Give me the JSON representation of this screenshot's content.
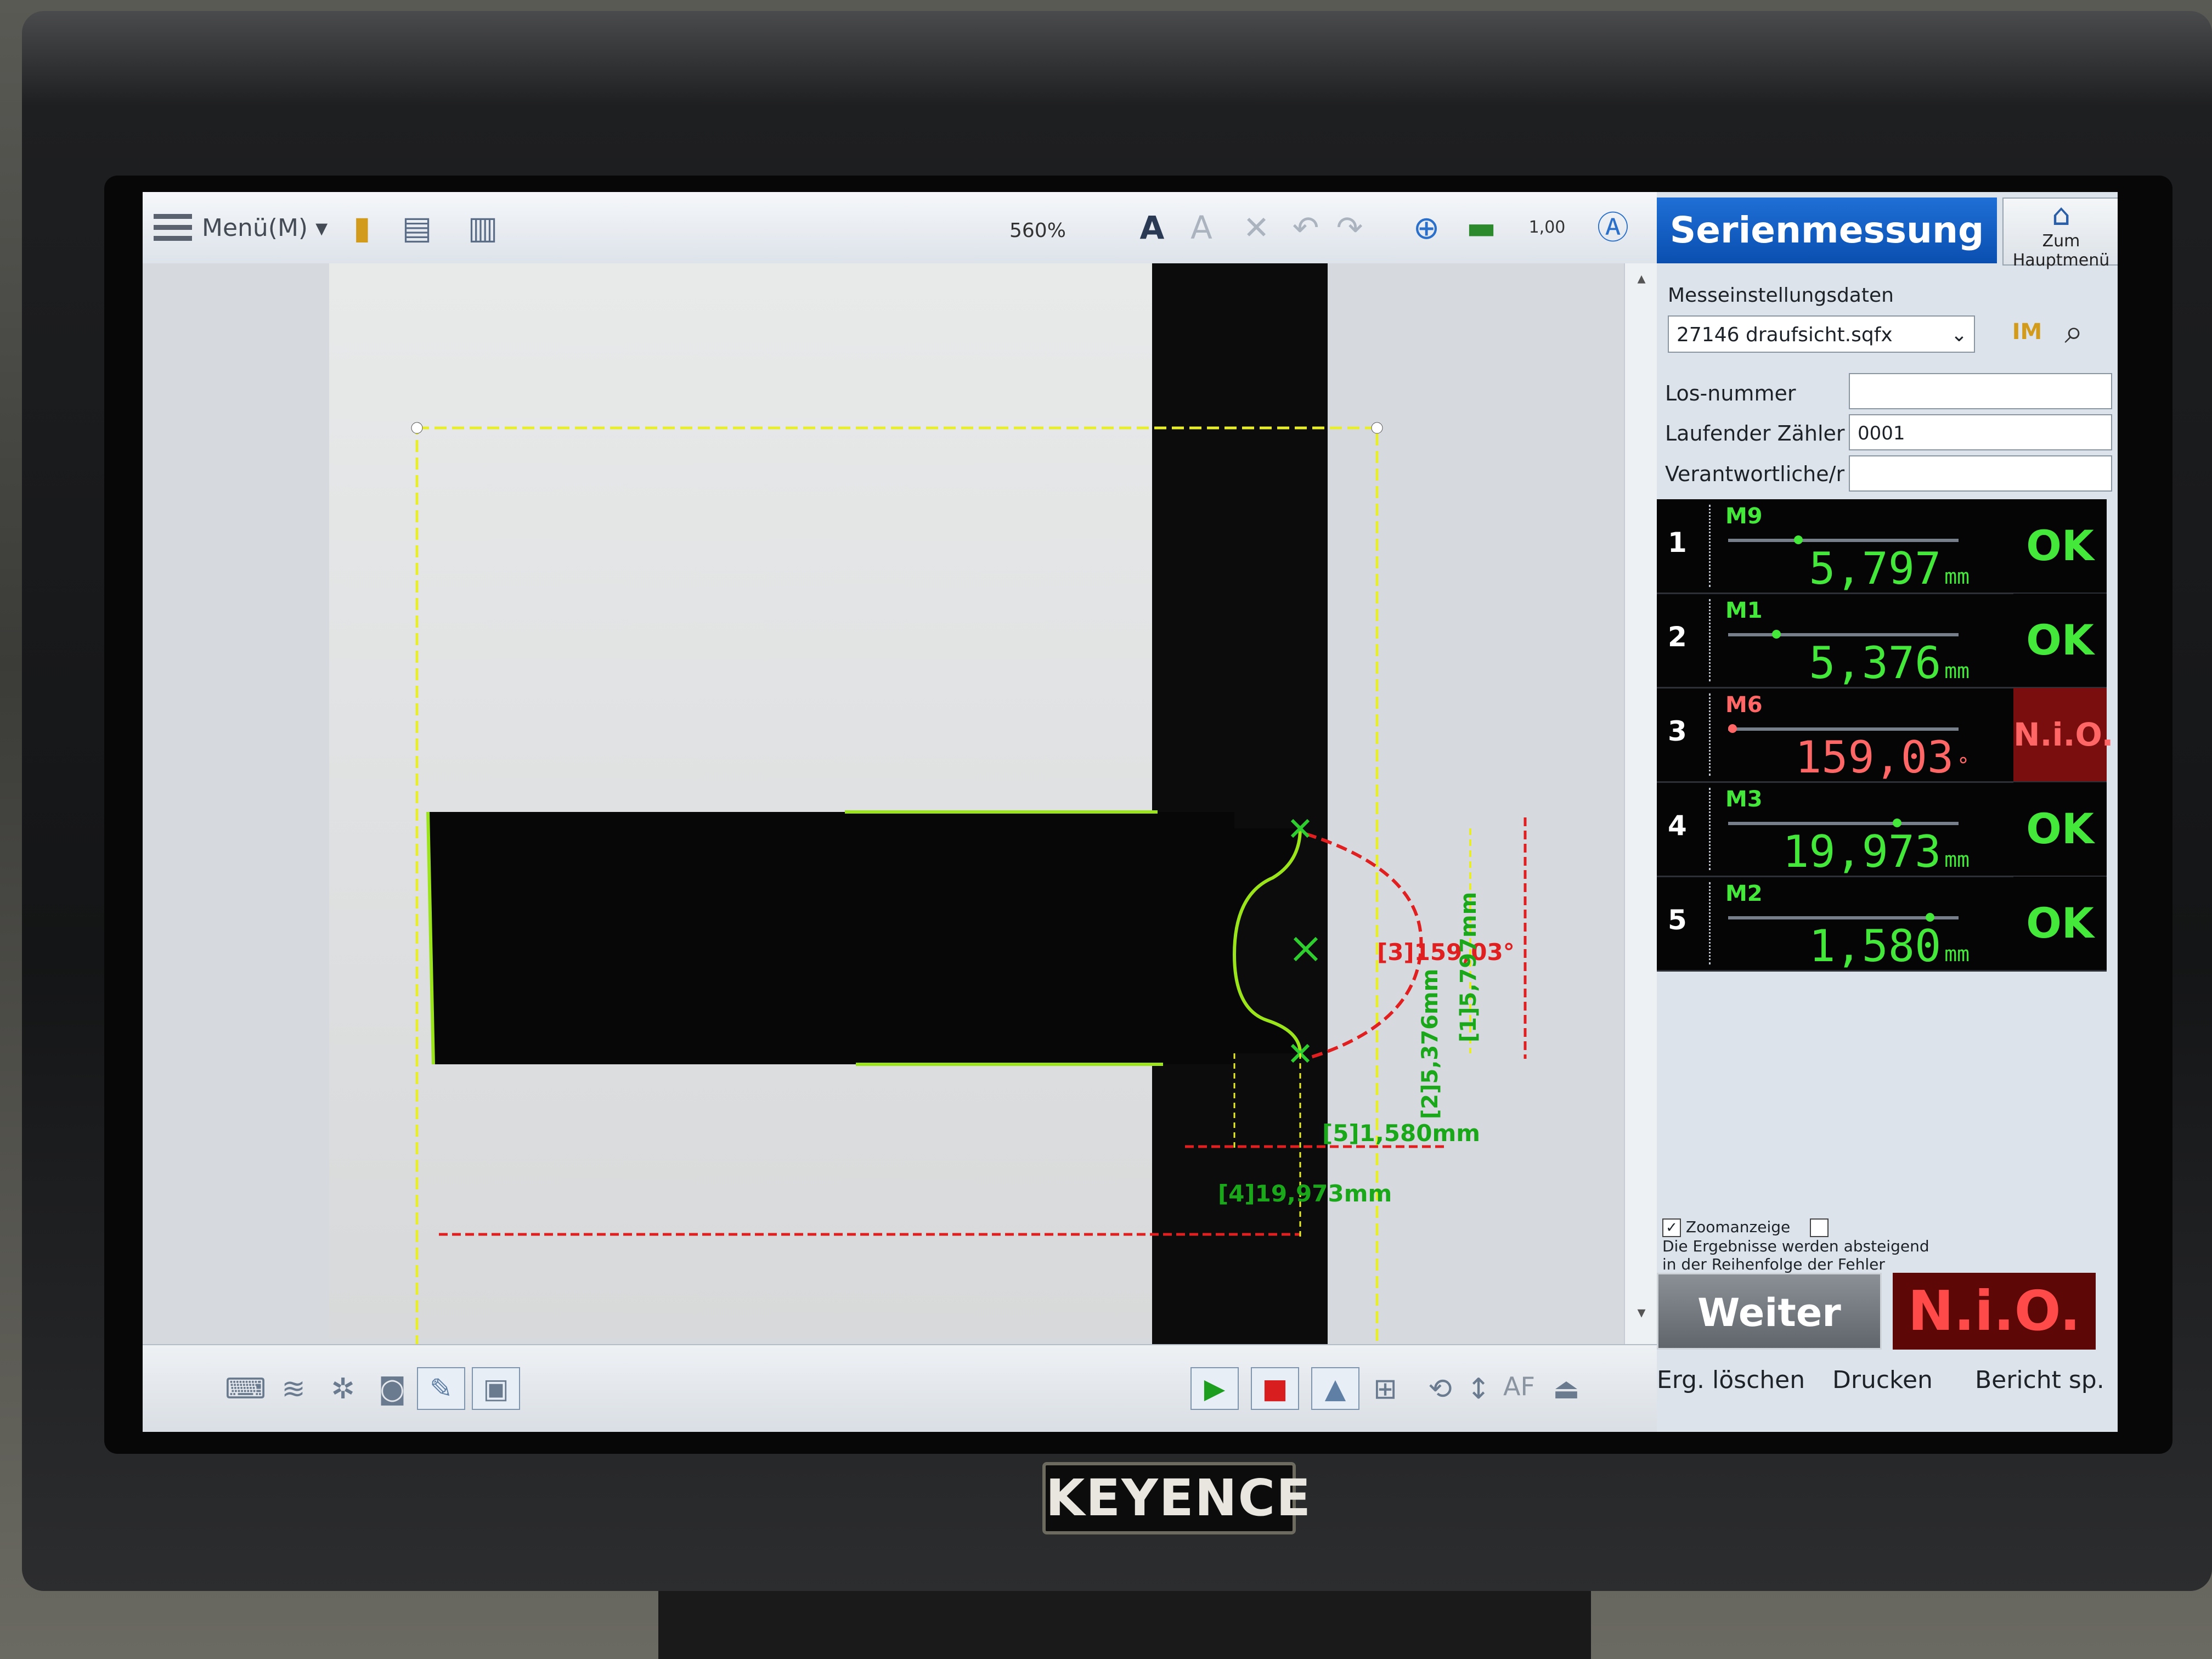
{
  "toolbar": {
    "menu_label": "Menü(M)",
    "zoom": "560%",
    "scale_label": "1,00"
  },
  "overlay": {
    "m3_label": "[3]159,03°",
    "m9_label": "[1]5,797mm",
    "m1_label": "[2]5,376mm",
    "m2_label": "[5]1,580mm",
    "m3dist_label": "[4]19,973mm"
  },
  "bottombar": {
    "af_label": "AF"
  },
  "panel": {
    "title": "Serienmessung",
    "home_label": "Zum Hauptmenü",
    "settings_label": "Messeinstellungsdaten",
    "settings_file": "27146 draufsicht.sqfx",
    "fields": [
      {
        "label": "Los-nummer",
        "value": ""
      },
      {
        "label": "Laufender Zähler",
        "value": "0001"
      },
      {
        "label": "Verantwortliche/r",
        "value": ""
      }
    ],
    "results": [
      {
        "num": "1",
        "name": "M9",
        "value": "5,797",
        "unit": "mm",
        "status": "OK",
        "level": 0.3
      },
      {
        "num": "2",
        "name": "M1",
        "value": "5,376",
        "unit": "mm",
        "status": "OK",
        "level": 0.2
      },
      {
        "num": "3",
        "name": "M6",
        "value": "159,03",
        "unit": "°",
        "status": "N.i.O.",
        "level": 0.0
      },
      {
        "num": "4",
        "name": "M3",
        "value": "19,973",
        "unit": "mm",
        "status": "OK",
        "level": 0.75
      },
      {
        "num": "5",
        "name": "M2",
        "value": "1,580",
        "unit": "mm",
        "status": "OK",
        "level": 0.9
      }
    ],
    "zoom_check": "Zoomanzeige",
    "sort_check": "Die Ergebnisse werden absteigend in der Reihenfolge der Fehler angezeigt.",
    "weiter": "Weiter",
    "overall": "N.i.O.",
    "actions": [
      "Erg. löschen",
      "Drucken",
      "Bericht sp."
    ]
  },
  "brand": "KEYENCE",
  "colors": {
    "ok": "#44e83a",
    "nio": "#ff6666",
    "title_blue": "#0a4fb0",
    "measure_red": "#e02020",
    "roi_yellow": "#e8ee2a"
  }
}
